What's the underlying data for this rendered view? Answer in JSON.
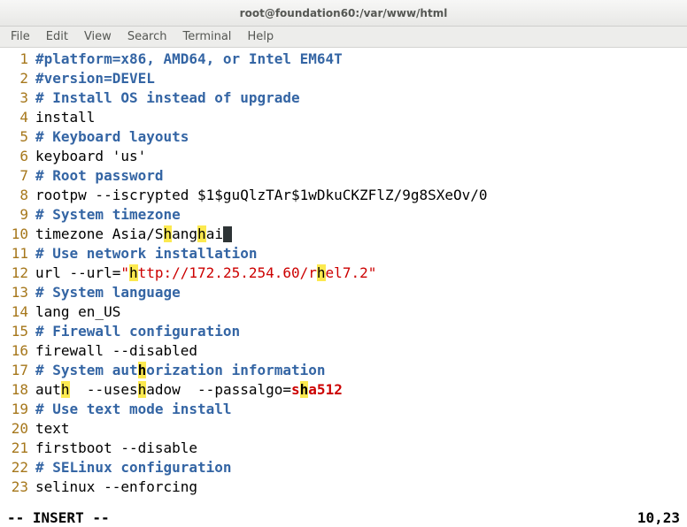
{
  "window": {
    "title": "root@foundation60:/var/www/html"
  },
  "menu": {
    "items": [
      {
        "label": "File"
      },
      {
        "label": "Edit"
      },
      {
        "label": "View"
      },
      {
        "label": "Search"
      },
      {
        "label": "Terminal"
      },
      {
        "label": "Help"
      }
    ]
  },
  "editor": {
    "lines": [
      {
        "n": "1",
        "parts": [
          {
            "cls": "c-comment",
            "text": "#platform=x86, AMD64, or Intel EM64T"
          }
        ]
      },
      {
        "n": "2",
        "parts": [
          {
            "cls": "c-comment",
            "text": "#version=DEVEL"
          }
        ]
      },
      {
        "n": "3",
        "parts": [
          {
            "cls": "c-comment",
            "text": "# Install OS instead of upgrade"
          }
        ]
      },
      {
        "n": "4",
        "parts": [
          {
            "cls": "c-plain",
            "text": "install"
          }
        ]
      },
      {
        "n": "5",
        "parts": [
          {
            "cls": "c-comment",
            "text": "# Keyboard layouts"
          }
        ]
      },
      {
        "n": "6",
        "parts": [
          {
            "cls": "c-plain",
            "text": "keyboard 'us'"
          }
        ]
      },
      {
        "n": "7",
        "parts": [
          {
            "cls": "c-comment",
            "text": "# Root password"
          }
        ]
      },
      {
        "n": "8",
        "parts": [
          {
            "cls": "c-plain",
            "text": "rootpw --iscrypted $1$guQlzTAr$1wDkuCKZFlZ/9g8SXeOv/0"
          }
        ]
      },
      {
        "n": "9",
        "parts": [
          {
            "cls": "c-comment",
            "text": "# System timezone"
          }
        ]
      },
      {
        "n": "10",
        "parts": [
          {
            "cls": "c-plain",
            "text": "timezone Asia/S"
          },
          {
            "cls": "c-plain hl",
            "text": "h"
          },
          {
            "cls": "c-plain",
            "text": "ang"
          },
          {
            "cls": "c-plain hl",
            "text": "h"
          },
          {
            "cls": "c-plain",
            "text": "ai"
          },
          {
            "cls": "cursor",
            "text": ""
          }
        ]
      },
      {
        "n": "11",
        "parts": [
          {
            "cls": "c-comment",
            "text": "# Use network installation"
          }
        ]
      },
      {
        "n": "12",
        "parts": [
          {
            "cls": "c-plain",
            "text": "url --url="
          },
          {
            "cls": "c-string",
            "text": "\""
          },
          {
            "cls": "c-string hl",
            "text": "h"
          },
          {
            "cls": "c-string",
            "text": "ttp://172.25.254.60/r"
          },
          {
            "cls": "c-string hl",
            "text": "h"
          },
          {
            "cls": "c-string",
            "text": "el7.2\""
          }
        ]
      },
      {
        "n": "13",
        "parts": [
          {
            "cls": "c-comment",
            "text": "# System language"
          }
        ]
      },
      {
        "n": "14",
        "parts": [
          {
            "cls": "c-plain",
            "text": "lang en_US"
          }
        ]
      },
      {
        "n": "15",
        "parts": [
          {
            "cls": "c-comment",
            "text": "# Firewall configuration"
          }
        ]
      },
      {
        "n": "16",
        "parts": [
          {
            "cls": "c-plain",
            "text": "firewall --disabled"
          }
        ]
      },
      {
        "n": "17",
        "parts": [
          {
            "cls": "c-comment",
            "text": "# System aut"
          },
          {
            "cls": "c-comment hl",
            "text": "h"
          },
          {
            "cls": "c-comment",
            "text": "orization information"
          }
        ]
      },
      {
        "n": "18",
        "parts": [
          {
            "cls": "c-plain",
            "text": "aut"
          },
          {
            "cls": "c-plain hl",
            "text": "h"
          },
          {
            "cls": "c-plain",
            "text": "  --uses"
          },
          {
            "cls": "c-plain hl",
            "text": "h"
          },
          {
            "cls": "c-plain",
            "text": "adow  --passalgo="
          },
          {
            "cls": "c-key",
            "text": "s"
          },
          {
            "cls": "c-key hl",
            "text": "h"
          },
          {
            "cls": "c-key",
            "text": "a512"
          }
        ]
      },
      {
        "n": "19",
        "parts": [
          {
            "cls": "c-comment",
            "text": "# Use text mode install"
          }
        ]
      },
      {
        "n": "20",
        "parts": [
          {
            "cls": "c-plain",
            "text": "text"
          }
        ]
      },
      {
        "n": "21",
        "parts": [
          {
            "cls": "c-plain",
            "text": "firstboot --disable"
          }
        ]
      },
      {
        "n": "22",
        "parts": [
          {
            "cls": "c-comment",
            "text": "# SELinux configuration"
          }
        ]
      },
      {
        "n": "23",
        "parts": [
          {
            "cls": "c-plain",
            "text": "selinux --enforcing"
          }
        ]
      }
    ]
  },
  "status": {
    "mode": "-- INSERT --",
    "pos": "10,23"
  }
}
